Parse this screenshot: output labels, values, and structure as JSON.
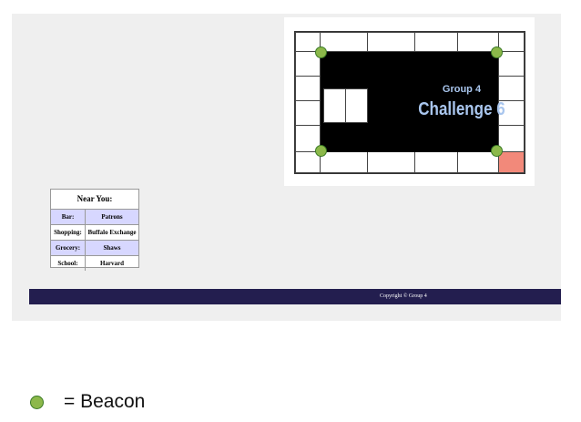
{
  "board": {
    "subtitle": "Group 4",
    "title": "Challenge 6",
    "highlight_color": "#f2897a",
    "beacon_color": "#8cb84a"
  },
  "near_you": {
    "title": "Near You:",
    "rows": [
      {
        "label": "Bar:",
        "value": "Patrons"
      },
      {
        "label": "Shopping:",
        "value": "Buffalo Exchange"
      },
      {
        "label": "Grocery:",
        "value": "Shaws"
      },
      {
        "label": "School:",
        "value": "Harvard"
      }
    ]
  },
  "footer": {
    "copyright": "Copyright © Group 4"
  },
  "legend": {
    "text": "= Beacon"
  }
}
